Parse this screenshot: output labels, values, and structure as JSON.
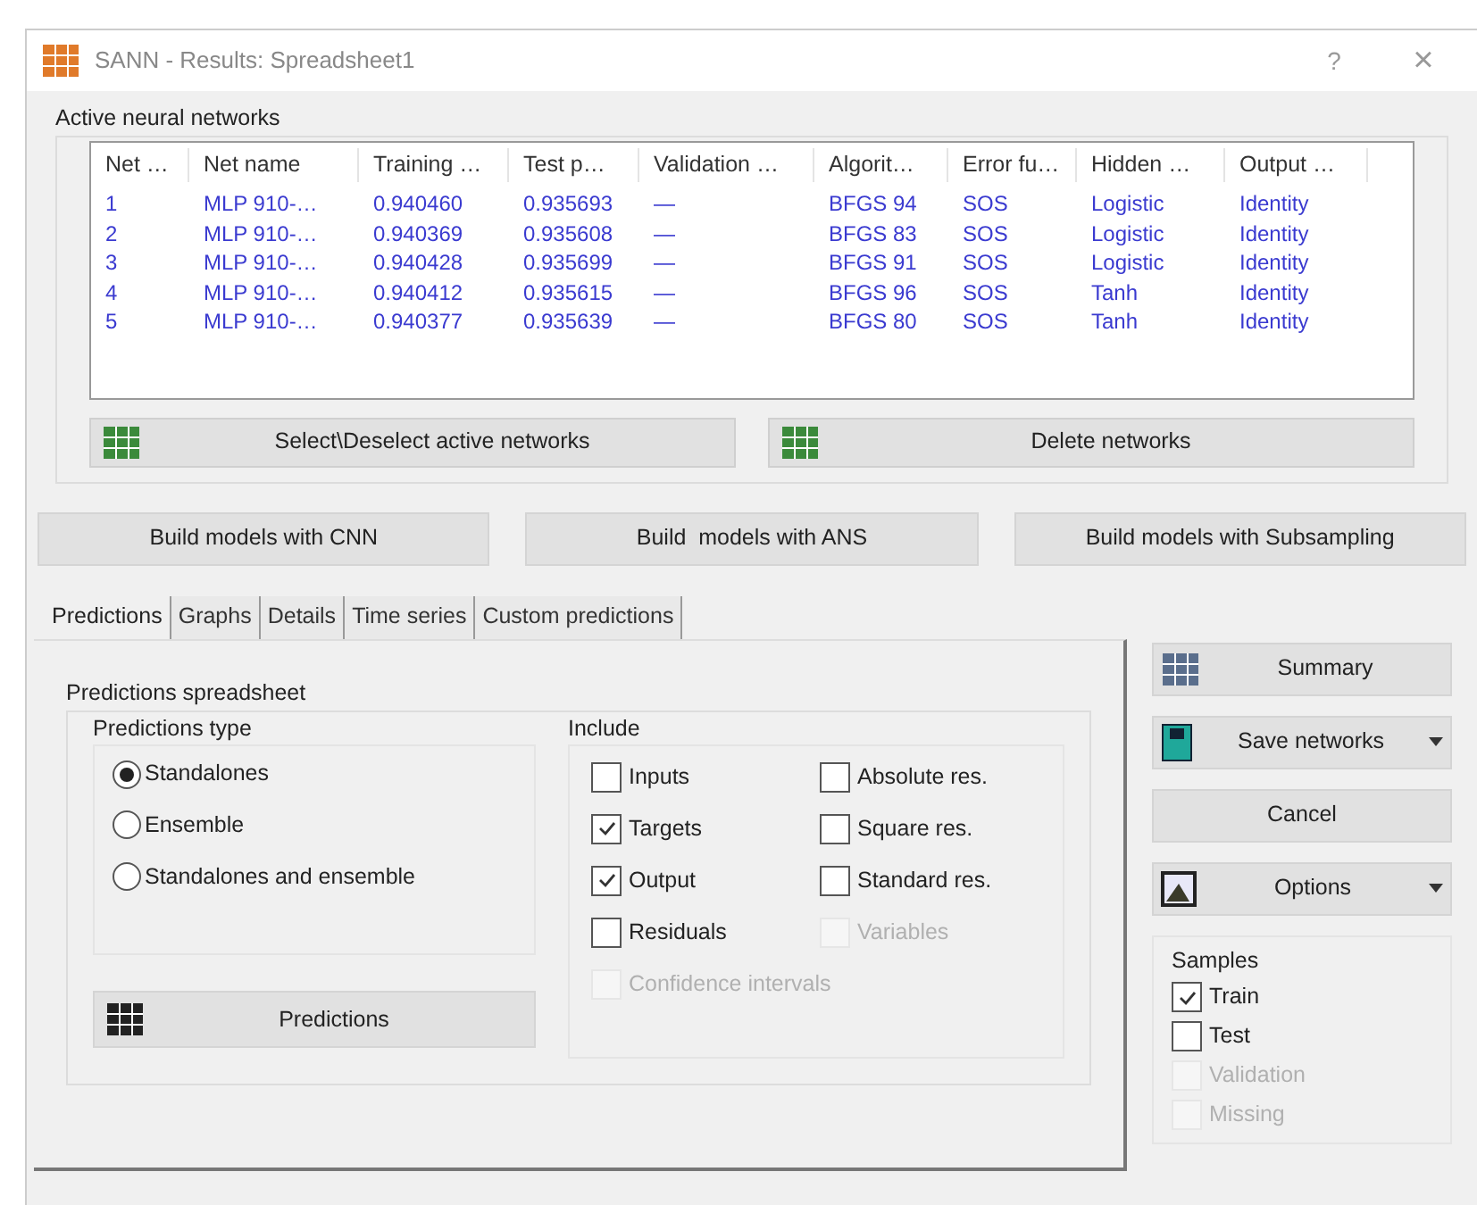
{
  "window": {
    "title": "SANN - Results: Spreadsheet1",
    "help": "?",
    "close": "×"
  },
  "networks": {
    "title": "Active neural networks",
    "columns": [
      "Net …",
      "Net name",
      "Training …",
      "Test p…",
      "Validation …",
      "Algorit…",
      "Error fu…",
      "Hidden …",
      "Output …"
    ],
    "rows": [
      [
        "1",
        "MLP 910-…",
        "0.940460",
        "0.935693",
        "—",
        "BFGS 94",
        "SOS",
        "Logistic",
        "Identity"
      ],
      [
        "2",
        "MLP 910-…",
        "0.940369",
        "0.935608",
        "—",
        "BFGS 83",
        "SOS",
        "Logistic",
        "Identity"
      ],
      [
        "3",
        "MLP 910-…",
        "0.940428",
        "0.935699",
        "—",
        "BFGS 91",
        "SOS",
        "Logistic",
        "Identity"
      ],
      [
        "4",
        "MLP 910-…",
        "0.940412",
        "0.935615",
        "—",
        "BFGS 96",
        "SOS",
        "Tanh",
        "Identity"
      ],
      [
        "5",
        "MLP 910-…",
        "0.940377",
        "0.935639",
        "—",
        "BFGS 80",
        "SOS",
        "Tanh",
        "Identity"
      ]
    ],
    "buttons": [
      "Select\\Deselect active networks",
      "Delete networks"
    ]
  },
  "build_buttons": [
    "Build models with CNN",
    "Build  models with ANS",
    "Build models with Subsampling"
  ],
  "tabs": [
    {
      "label": "Predictions",
      "selected": true
    },
    {
      "label": "Graphs",
      "selected": false
    },
    {
      "label": "Details",
      "selected": false
    },
    {
      "label": "Time series",
      "selected": false
    },
    {
      "label": "Custom predictions",
      "selected": false
    }
  ],
  "predictions": {
    "title": "Predictions spreadsheet",
    "type": {
      "title": "Predictions type",
      "options": [
        {
          "label": "Standalones",
          "selected": true
        },
        {
          "label": "Ensemble",
          "selected": false
        },
        {
          "label": "Standalones and ensemble",
          "selected": false
        }
      ]
    },
    "button": "Predictions",
    "include": {
      "title": "Include",
      "items": [
        {
          "label": "Inputs",
          "checked": false,
          "disabled": false
        },
        {
          "label": "Absolute res.",
          "checked": false,
          "disabled": false
        },
        {
          "label": "Targets",
          "checked": true,
          "disabled": false
        },
        {
          "label": "Square res.",
          "checked": false,
          "disabled": false
        },
        {
          "label": "Output",
          "checked": true,
          "disabled": false
        },
        {
          "label": "Standard res.",
          "checked": false,
          "disabled": false
        },
        {
          "label": "Residuals",
          "checked": false,
          "disabled": false
        },
        {
          "label": "Variables",
          "checked": false,
          "disabled": true
        },
        {
          "label": "Confidence intervals",
          "checked": false,
          "disabled": true
        }
      ]
    }
  },
  "side_buttons": [
    {
      "label": "Summary",
      "kind": "summary",
      "dropdown": false
    },
    {
      "label": "Save networks",
      "kind": "save",
      "dropdown": true
    },
    {
      "label": "Cancel",
      "kind": "plain",
      "dropdown": false
    },
    {
      "label": "Options",
      "kind": "options",
      "dropdown": true
    }
  ],
  "samples": {
    "title": "Samples",
    "items": [
      {
        "label": "Train",
        "checked": true,
        "disabled": false
      },
      {
        "label": "Test",
        "checked": false,
        "disabled": false
      },
      {
        "label": "Validation",
        "checked": false,
        "disabled": true
      },
      {
        "label": "Missing",
        "checked": false,
        "disabled": true
      }
    ]
  }
}
